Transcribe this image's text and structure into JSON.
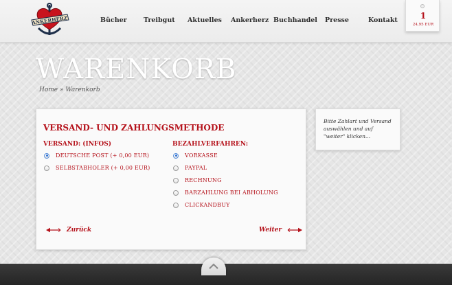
{
  "nav": {
    "items": [
      {
        "label": "Bücher"
      },
      {
        "label": "Treibgut"
      },
      {
        "label": "Aktuelles"
      },
      {
        "label": "Ankerherz"
      },
      {
        "label": "Buchhandel"
      },
      {
        "label": "Presse"
      },
      {
        "label": "Kontakt"
      }
    ]
  },
  "logo": {
    "text": "ANKERHERZ"
  },
  "cart": {
    "count": "1",
    "total": "24,95 EUR"
  },
  "page": {
    "title": "WARENKORB"
  },
  "breadcrumb": {
    "home": "Home",
    "separator": "»",
    "current": "Warenkorb"
  },
  "checkout": {
    "title": "VERSAND- UND ZAHLUNGSMETHODE",
    "shipping": {
      "title": "VERSAND: (INFOS)",
      "options": [
        {
          "label": "DEUTSCHE POST (+ 0,00 EUR)",
          "checked": true
        },
        {
          "label": "SELBSTABHOLER (+ 0,00 EUR)",
          "checked": false
        }
      ]
    },
    "payment": {
      "title": "BEZAHLVERFAHREN:",
      "options": [
        {
          "label": "VORKASSE",
          "checked": true
        },
        {
          "label": "PAYPAL",
          "checked": false
        },
        {
          "label": "RECHNUNG",
          "checked": false
        },
        {
          "label": "BARZAHLUNG BEI ABHOLUNG",
          "checked": false
        },
        {
          "label": "CLICKANDBUY",
          "checked": false
        }
      ]
    },
    "back_label": "Zurück",
    "next_label": "Weiter"
  },
  "info": {
    "text": "Bitte Zahlart und Versand auswählen und auf \"weiter\" klicken..."
  },
  "colors": {
    "accent": "#b5121b",
    "radio_checked": "#2a6fd6",
    "footer": "#2b2b2b"
  }
}
